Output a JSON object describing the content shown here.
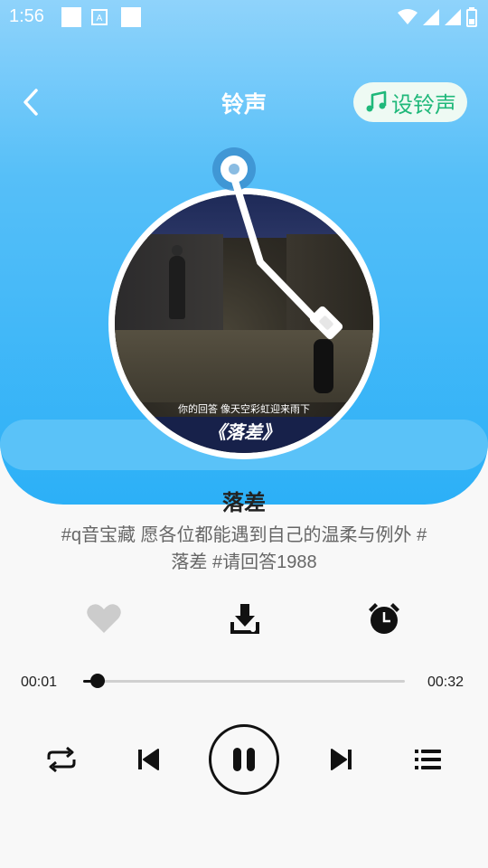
{
  "status_bar": {
    "time": "1:56",
    "notification_letter": "A",
    "icons": [
      "notification-square-icon",
      "text-notification-icon",
      "notification-square-icon",
      "wifi-icon",
      "signal-icon",
      "signal-icon",
      "battery-icon"
    ]
  },
  "header": {
    "title": "铃声",
    "set_ringtone_label": "设铃声",
    "back_icon": "chevron-left-icon",
    "set_ringtone_icon": "music-note-icon"
  },
  "cover": {
    "subtitle_text": "你的回答 像天空彩虹迎来雨下",
    "title_text": "《落差》"
  },
  "song": {
    "title": "落差",
    "description": "#q音宝藏 愿各位都能遇到自己的温柔与例外 #落差 #请回答1988"
  },
  "actions": {
    "like_icon": "heart-icon",
    "download_icon": "download-icon",
    "alarm_icon": "alarm-clock-icon"
  },
  "progress": {
    "current_time": "00:01",
    "total_time": "00:32",
    "fraction": 0.045
  },
  "controls": {
    "repeat_icon": "repeat-icon",
    "prev_icon": "skip-previous-icon",
    "pause_icon": "pause-icon",
    "next_icon": "skip-next-icon",
    "playlist_icon": "playlist-icon"
  },
  "colors": {
    "header_gradient_top": "#8fd3fb",
    "header_gradient_bottom": "#2cb0f7",
    "set_ringtone_text": "#1fb87a",
    "set_ringtone_bg": "#eefaf3",
    "like_inactive": "#cccccc",
    "primary_icon": "#111111"
  }
}
